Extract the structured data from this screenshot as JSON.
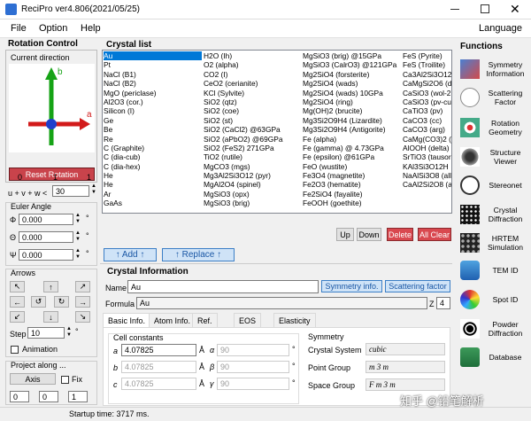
{
  "app": {
    "title": "ReciPro  ver4.806(2021/05/25)"
  },
  "menu": {
    "file": "File",
    "option": "Option",
    "help": "Help",
    "language": "Language"
  },
  "rotation": {
    "title": "Rotation Control",
    "current_direction": "Current direction",
    "axis_b": "b",
    "axis_a": "a",
    "reset_label": "Reset Rotation",
    "uvw_label": "u + v + w <",
    "uvw_value": "30",
    "uvw_ticks": [
      "0",
      "1",
      "1"
    ],
    "euler_title": "Euler Angle",
    "euler_phi": "0.000",
    "euler_theta": "0.000",
    "euler_psi": "0.000",
    "euler_phi_sym": "Φ",
    "euler_theta_sym": "Θ",
    "euler_psi_sym": "Ψ",
    "deg": "°",
    "arrows_title": "Arrows",
    "step_label": "Step",
    "step_value": "10",
    "step_unit": "°",
    "animation_label": "Animation",
    "project_title": "Project along ...",
    "axis_button": "Axis",
    "fix_label": "Fix",
    "project_values": [
      "0",
      "0",
      "1"
    ]
  },
  "crystal_list": {
    "title": "Crystal list",
    "col1": [
      "Au",
      "Pt",
      "NaCl (B1)",
      "NaCl (B2)",
      "MgO (periclase)",
      "Al2O3 (cor.)",
      "Silicon (I)",
      "Ge",
      "Be",
      "Re",
      "C (Graphite)",
      "C (dia-cub)",
      "C (dia-hex)",
      "He",
      "He",
      "Ar",
      "GaAs"
    ],
    "col2": [
      "H2O (Ih)",
      "O2 (alpha)",
      "CO2 (I)",
      "CeO2 (cerianite)",
      "KCl (Sylvite)",
      "SiO2 (qtz)",
      "SiO2 (coe)",
      "SiO2 (st)",
      "SiO2 (CaCl2) @63GPa",
      "SiO2 (aPbO2) @69GPa",
      "SiO2 (FeS2) 271GPa",
      "TiO2 (rutile)",
      "MgCO3 (mgs)",
      "Mg3Al2Si3O12 (pyr)",
      "MgAl2O4 (spinel)",
      "MgSiO3 (opx)",
      "MgSiO3 (brig)"
    ],
    "col3": [
      "MgSiO3 (brig) @15GPa",
      "MgSiO3 (CalrO3) @121GPa",
      "Mg2SiO4 (forsterite)",
      "Mg2SiO4 (wads)",
      "Mg2SiO4 (wads) 10GPa",
      "Mg2SiO4 (ring)",
      "Mg(OH)2 (brucite)",
      "Mg3Si2O9H4 (Lizardite)",
      "Mg3Si2O9H4 (Antigorite)",
      "Fe (alpha)",
      "Fe (gamma) @ 4.73GPa",
      "Fe (epsilon) @61GPa",
      "FeO (wustite)",
      "Fe3O4 (magnetite)",
      "Fe2O3 (hematite)",
      "Fe2SiO4 (fayalite)",
      "FeOOH (goethite)"
    ],
    "col4": [
      "FeS (Pyrite)",
      "FeS (Troilite)",
      "Ca3Al2Si3O12",
      "CaMgSi2O6 (d",
      "CaSiO3 (wol-2",
      "CaSiO3 (pv-cu",
      "CaTiO3 (pv)",
      "CaCO3 (cc)",
      "CaCO3 (arg)",
      "CaMg(CO3)2 (",
      "AlOOH (delta)",
      "SrTiO3 (tausor",
      "KAl3Si3O12H",
      "NaAlSi3O8 (all",
      "CaAl2Si2O8 (a",
      ""
    ],
    "up": "Up",
    "down": "Down",
    "delete": "Delete",
    "all_clear": "All Clear"
  },
  "actions": {
    "add": "↑ Add ↑",
    "replace": "↑ Replace ↑"
  },
  "crystal_info": {
    "title": "Crystal Information",
    "name_label": "Name",
    "name_value": "Au",
    "symmetry_btn": "Symmetry info.",
    "scattering_btn": "Scattering factor",
    "formula_label": "Formula",
    "formula_value": "Au",
    "z_label": "Z",
    "z_value": "4",
    "tabs": [
      "Basic Info.",
      "Atom Info.",
      "Ref.",
      "EOS",
      "Elasticity"
    ],
    "cell_title": "Cell constants",
    "a": "4.07825",
    "b": "4.07825",
    "c": "4.07825",
    "alpha": "90",
    "beta": "90",
    "gamma": "90",
    "a_sym": "a",
    "b_sym": "b",
    "c_sym": "c",
    "ang": "Å",
    "alpha_sym": "α",
    "beta_sym": "β",
    "gamma_sym": "γ",
    "sym_title": "Symmetry",
    "crystal_system_label": "Crystal System",
    "crystal_system": "cubic",
    "point_group_label": "Point Group",
    "point_group": "m 3 m",
    "space_group_label": "Space Group",
    "space_group": "F m 3 m"
  },
  "functions": {
    "title": "Functions",
    "items": [
      "Symmetry Information",
      "Scattering Factor",
      "Rotation Geometry",
      "Structure Viewer",
      "Stereonet",
      "Crystal Diffraction",
      "HRTEM Simulation",
      "TEM ID",
      "Spot ID",
      "Powder Diffraction",
      "Database"
    ]
  },
  "status": {
    "text": "Startup time: 3717 ms."
  },
  "watermark": "知乎 @铅笔解析",
  "colors": {
    "accent": "#0078d7",
    "reset_red": "#c9434b",
    "axis_red": "#d21a1a",
    "axis_green": "#16a316",
    "axis_blue": "#1f3fcc"
  }
}
